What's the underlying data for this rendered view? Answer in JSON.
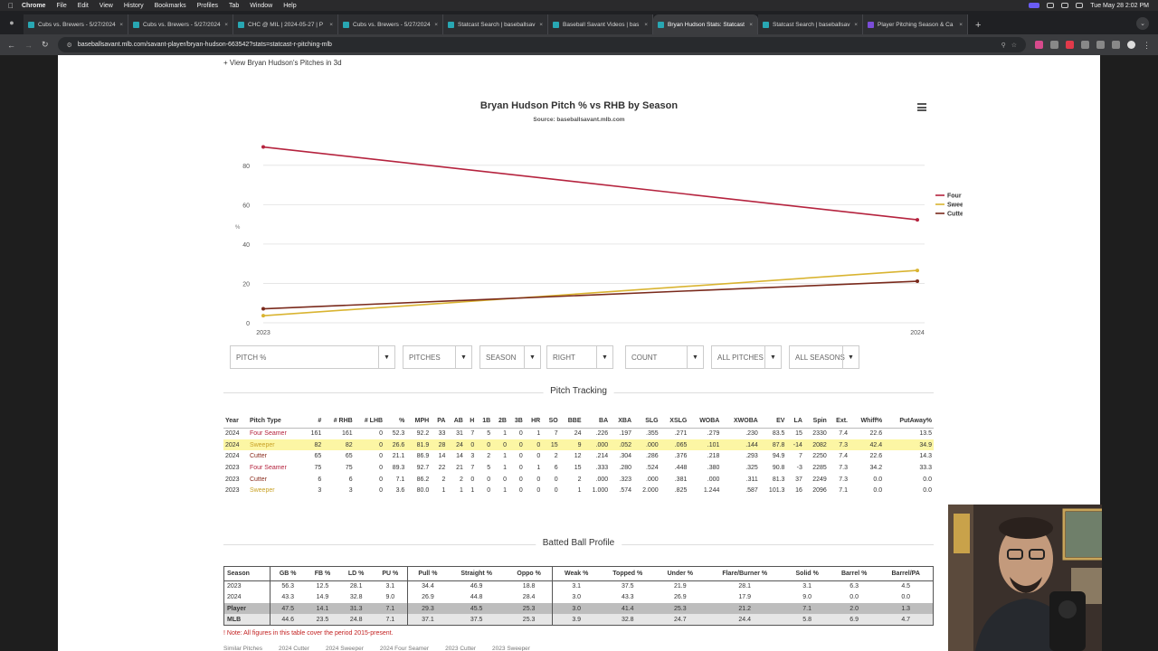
{
  "menubar": {
    "app": "Chrome",
    "items": [
      "File",
      "Edit",
      "View",
      "History",
      "Bookmarks",
      "Profiles",
      "Tab",
      "Window",
      "Help"
    ],
    "clock": "Tue May 28  2:02 PM"
  },
  "tabs": [
    {
      "title": "Cubs vs. Brewers - 5/27/2024",
      "icon": "mlb-favicon",
      "active": false
    },
    {
      "title": "Cubs vs. Brewers - 5/27/2024",
      "icon": "mlb-favicon",
      "active": false
    },
    {
      "title": "CHC @ MIL | 2024-05-27 | P",
      "icon": "mlb-favicon",
      "active": false
    },
    {
      "title": "Cubs vs. Brewers - 5/27/2024",
      "icon": "mlb-favicon",
      "active": false
    },
    {
      "title": "Statcast Search | baseballsav",
      "icon": "savant-favicon",
      "active": false
    },
    {
      "title": "Baseball Savant Videos | bas",
      "icon": "savant-favicon",
      "active": false
    },
    {
      "title": "Bryan Hudson Stats: Statcast",
      "icon": "savant-favicon",
      "active": true
    },
    {
      "title": "Statcast Search | baseballsav",
      "icon": "savant-favicon",
      "active": false
    },
    {
      "title": "Player Pitching Season & Ca",
      "icon": "purple-favicon",
      "active": false
    }
  ],
  "toolbar": {
    "url": "baseballsavant.mlb.com/savant-player/bryan-hudson-663542?stats=statcast-r-pitching-mlb"
  },
  "page": {
    "view3d": "+ View Bryan Hudson's Pitches in 3d"
  },
  "chart_data": {
    "type": "line",
    "title": "Bryan Hudson Pitch % vs RHB by Season",
    "subtitle": "Source: baseballsavant.mlb.com",
    "x": [
      "2023",
      "2024"
    ],
    "ylim": [
      0,
      90
    ],
    "yticks": [
      0,
      20,
      40,
      60,
      80
    ],
    "ylabel": "%",
    "series": [
      {
        "name": "Four Seamer",
        "color": "#b5233e",
        "values": [
          89.3,
          52.3
        ]
      },
      {
        "name": "Sweeper",
        "color": "#d9b431",
        "values": [
          3.6,
          26.6
        ]
      },
      {
        "name": "Cutter",
        "color": "#7a2a1c",
        "values": [
          7.1,
          21.1
        ]
      }
    ],
    "legend": "right"
  },
  "filters": [
    "PITCH %",
    "PITCHES",
    "SEASON",
    "RIGHT",
    "COUNT",
    "ALL PITCHES",
    "ALL SEASONS"
  ],
  "pitch_tracking": {
    "title": "Pitch Tracking",
    "headers": [
      "Year",
      "Pitch Type",
      "#",
      "# RHB",
      "# LHB",
      "%",
      "MPH",
      "PA",
      "AB",
      "H",
      "1B",
      "2B",
      "3B",
      "HR",
      "SO",
      "BBE",
      "BA",
      "XBA",
      "SLG",
      "XSLG",
      "WOBA",
      "XWOBA",
      "EV",
      "LA",
      "Spin",
      "Ext.",
      "Whiff%",
      "PutAway%"
    ],
    "rows": [
      [
        "2024",
        "Four Seamer",
        "161",
        "161",
        "0",
        "52.3",
        "92.2",
        "33",
        "31",
        "7",
        "5",
        "1",
        "0",
        "1",
        "7",
        "24",
        ".226",
        ".197",
        ".355",
        ".271",
        ".279",
        ".230",
        "83.5",
        "15",
        "2330",
        "7.4",
        "22.6",
        "13.5"
      ],
      [
        "2024",
        "Sweeper",
        "82",
        "82",
        "0",
        "26.6",
        "81.9",
        "28",
        "24",
        "0",
        "0",
        "0",
        "0",
        "0",
        "15",
        "9",
        ".000",
        ".052",
        ".000",
        ".065",
        ".101",
        ".144",
        "87.8",
        "-14",
        "2082",
        "7.3",
        "42.4",
        "34.9"
      ],
      [
        "2024",
        "Cutter",
        "65",
        "65",
        "0",
        "21.1",
        "86.9",
        "14",
        "14",
        "3",
        "2",
        "1",
        "0",
        "0",
        "2",
        "12",
        ".214",
        ".304",
        ".286",
        ".376",
        ".218",
        ".293",
        "94.9",
        "7",
        "2250",
        "7.4",
        "22.6",
        "14.3"
      ],
      [
        "2023",
        "Four Seamer",
        "75",
        "75",
        "0",
        "89.3",
        "92.7",
        "22",
        "21",
        "7",
        "5",
        "1",
        "0",
        "1",
        "6",
        "15",
        ".333",
        ".280",
        ".524",
        ".448",
        ".380",
        ".325",
        "90.8",
        "-3",
        "2285",
        "7.3",
        "34.2",
        "33.3"
      ],
      [
        "2023",
        "Cutter",
        "6",
        "6",
        "0",
        "7.1",
        "86.2",
        "2",
        "2",
        "0",
        "0",
        "0",
        "0",
        "0",
        "0",
        "2",
        ".000",
        ".323",
        ".000",
        ".381",
        ".000",
        ".311",
        "81.3",
        "37",
        "2249",
        "7.3",
        "0.0",
        "0.0"
      ],
      [
        "2023",
        "Sweeper",
        "3",
        "3",
        "0",
        "3.6",
        "80.0",
        "1",
        "1",
        "1",
        "0",
        "1",
        "0",
        "0",
        "0",
        "1",
        "1.000",
        ".574",
        "2.000",
        ".825",
        "1.244",
        ".587",
        "101.3",
        "16",
        "2096",
        "7.1",
        "0.0",
        "0.0"
      ]
    ]
  },
  "batted_ball": {
    "title": "Batted Ball Profile",
    "headers": [
      "Season",
      "GB %",
      "FB %",
      "LD %",
      "PU %",
      "Pull %",
      "Straight %",
      "Oppo %",
      "Weak %",
      "Topped %",
      "Under %",
      "Flare/Burner %",
      "Solid %",
      "Barrel %",
      "Barrel/PA"
    ],
    "rows": [
      [
        "2023",
        "56.3",
        "12.5",
        "28.1",
        "3.1",
        "34.4",
        "46.9",
        "18.8",
        "3.1",
        "37.5",
        "21.9",
        "28.1",
        "3.1",
        "6.3",
        "4.5"
      ],
      [
        "2024",
        "43.3",
        "14.9",
        "32.8",
        "9.0",
        "26.9",
        "44.8",
        "28.4",
        "3.0",
        "43.3",
        "26.9",
        "17.9",
        "9.0",
        "0.0",
        "0.0"
      ],
      [
        "Player",
        "47.5",
        "14.1",
        "31.3",
        "7.1",
        "29.3",
        "45.5",
        "25.3",
        "3.0",
        "41.4",
        "25.3",
        "21.2",
        "7.1",
        "2.0",
        "1.3"
      ],
      [
        "MLB",
        "44.6",
        "23.5",
        "24.8",
        "7.1",
        "37.1",
        "37.5",
        "25.3",
        "3.9",
        "32.8",
        "24.7",
        "24.4",
        "5.8",
        "6.9",
        "4.7"
      ]
    ],
    "note": "! Note: All figures in this table cover the period 2015-present."
  },
  "footer_links": [
    "Similar Pitches",
    "2024 Cutter",
    "2024 Sweeper",
    "2024 Four Seamer",
    "2023 Cutter",
    "2023 Sweeper"
  ],
  "colors": {
    "four_seamer": "#b5233e",
    "sweeper": "#c9a227",
    "cutter": "#8a2c1e",
    "highlight_row": "#fcf6a4",
    "selection": "#b5d3f7",
    "note": "#c21f1f"
  }
}
